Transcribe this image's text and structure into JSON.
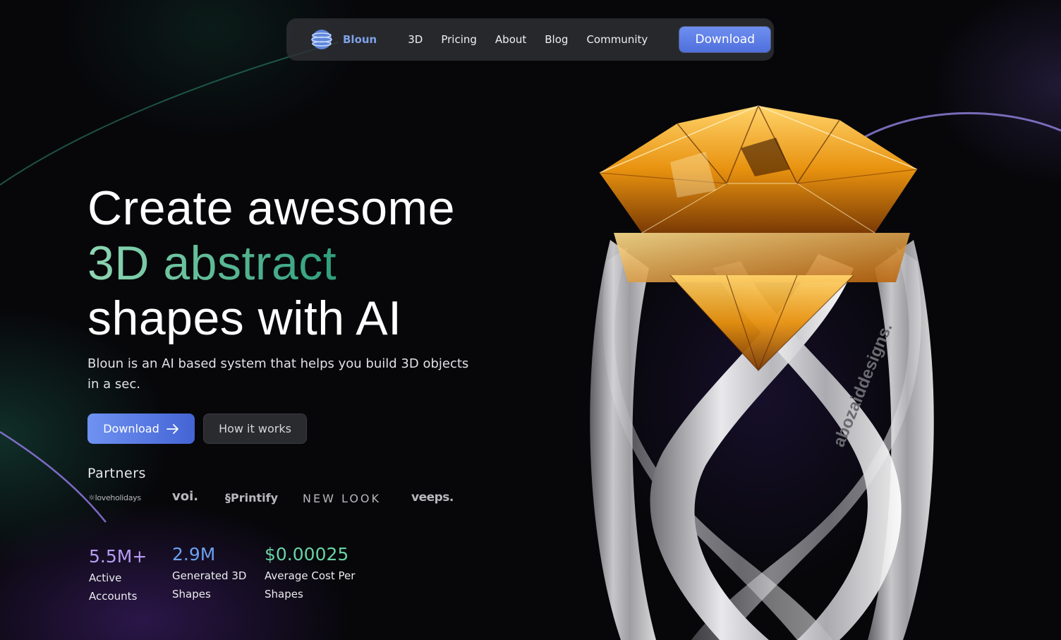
{
  "nav": {
    "brand": "Bloun",
    "links": [
      "3D",
      "Pricing",
      "About",
      "Blog",
      "Community"
    ],
    "download_label": "Download"
  },
  "hero": {
    "title_line1": "Create awesome",
    "title_line2": "3D abstract",
    "title_line3": "shapes with AI",
    "subtitle": "Bloun is an AI based system that helps you build 3D objects in a sec.",
    "primary_button": "Download",
    "secondary_button": "How it works"
  },
  "partners": {
    "title": "Partners",
    "logos": [
      "loveholidays",
      "voi.",
      "Printify",
      "NEW LOOK",
      "veeps."
    ]
  },
  "stats": [
    {
      "value": "5.5M+",
      "label": "Active Accounts"
    },
    {
      "value": "2.9M",
      "label": "Generated 3D Shapes"
    },
    {
      "value": "$0.00025",
      "label": "Average Cost Per Shapes"
    }
  ],
  "artwork": {
    "engraving": "abozaiddesigns."
  },
  "colors": {
    "accent_blue": "#5f80e8",
    "accent_green": "#3fae88",
    "gem_orange": "#e8960f"
  }
}
